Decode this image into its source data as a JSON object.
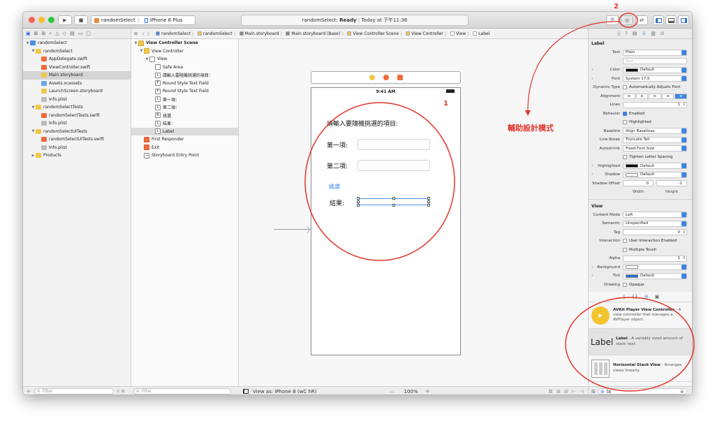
{
  "window": {
    "scheme_name": "randomSelect",
    "device": "iPhone 8 Plus",
    "status_project": "randomSelect:",
    "status_state": "Ready",
    "status_time": "Today at 下午11:38"
  },
  "jumpbar": [
    "randomSelect",
    "randomSelect",
    "Main.storyboard",
    "Main.storyboard (Base)",
    "View Controller Scene",
    "View Controller",
    "View",
    "Label"
  ],
  "navigator": [
    {
      "label": "randomSelect",
      "indent": 0,
      "tri": "▼",
      "icon": "#4a8ee8"
    },
    {
      "label": "randomSelect",
      "indent": 1,
      "tri": "▼",
      "icon": "#f0c64a"
    },
    {
      "label": "AppDelegate.swift",
      "indent": 2,
      "tri": "",
      "icon": "#f26b3a"
    },
    {
      "label": "ViewController.swift",
      "indent": 2,
      "tri": "",
      "icon": "#f26b3a"
    },
    {
      "label": "Main.storyboard",
      "indent": 2,
      "tri": "",
      "icon": "#f0c64a",
      "selected": true
    },
    {
      "label": "Assets.xcassets",
      "indent": 2,
      "tri": "",
      "icon": "#6aa7e6"
    },
    {
      "label": "LaunchScreen.storyboard",
      "indent": 2,
      "tri": "",
      "icon": "#f0c64a"
    },
    {
      "label": "Info.plist",
      "indent": 2,
      "tri": "",
      "icon": "#bbbbbb"
    },
    {
      "label": "randomSelectTests",
      "indent": 1,
      "tri": "▼",
      "icon": "#f0c64a"
    },
    {
      "label": "randomSelectTests.swift",
      "indent": 2,
      "tri": "",
      "icon": "#f26b3a"
    },
    {
      "label": "Info.plist",
      "indent": 2,
      "tri": "",
      "icon": "#bbbbbb"
    },
    {
      "label": "randomSelectUITests",
      "indent": 1,
      "tri": "▼",
      "icon": "#f0c64a"
    },
    {
      "label": "randomSelectUITests.swift",
      "indent": 2,
      "tri": "",
      "icon": "#f26b3a"
    },
    {
      "label": "Info.plist",
      "indent": 2,
      "tri": "",
      "icon": "#bbbbbb"
    },
    {
      "label": "Products",
      "indent": 1,
      "tri": "▶",
      "icon": "#f0c64a"
    }
  ],
  "outline": [
    {
      "label": "View Controller Scene",
      "indent": 0,
      "tri": "▼",
      "glyph": "",
      "bold": true
    },
    {
      "label": "View Controller",
      "indent": 1,
      "tri": "▼",
      "glyph": ""
    },
    {
      "label": "View",
      "indent": 2,
      "tri": "▼",
      "glyph": ""
    },
    {
      "label": "Safe Area",
      "indent": 3,
      "tri": "",
      "glyph": ""
    },
    {
      "label": "請輸入要隨機挑選的項目：",
      "indent": 3,
      "tri": "",
      "glyph": "L"
    },
    {
      "label": "Round Style Text Field",
      "indent": 3,
      "tri": "",
      "glyph": "F"
    },
    {
      "label": "Round Style Text Field",
      "indent": 3,
      "tri": "",
      "glyph": "F"
    },
    {
      "label": "第一項：",
      "indent": 3,
      "tri": "",
      "glyph": "L"
    },
    {
      "label": "第二項：",
      "indent": 3,
      "tri": "",
      "glyph": "L"
    },
    {
      "label": "挑選",
      "indent": 3,
      "tri": "",
      "glyph": "B"
    },
    {
      "label": "結果：",
      "indent": 3,
      "tri": "",
      "glyph": "L"
    },
    {
      "label": "Label",
      "indent": 3,
      "tri": "",
      "glyph": "L",
      "selected": true
    },
    {
      "label": "First Responder",
      "indent": 1,
      "tri": "",
      "glyph": ""
    },
    {
      "label": "Exit",
      "indent": 1,
      "tri": "",
      "glyph": ""
    },
    {
      "label": "Storyboard Entry Point",
      "indent": 1,
      "tri": "",
      "glyph": "→"
    }
  ],
  "phone": {
    "time": "9:41 AM",
    "prompt": "請輸入要隨機挑選的項目:",
    "item1": "第一項:",
    "item2": "第二項:",
    "pick": "挑選",
    "result": "結果:"
  },
  "canvas_footer": {
    "view_as": "View as: iPhone 8 (wC hR)",
    "zoom": "100%",
    "minus": "—",
    "plus": "+"
  },
  "filters": {
    "nav": "Filter",
    "outline": "Filter"
  },
  "inspector": {
    "label_section": "Label",
    "rows1": [
      {
        "label": "Text",
        "value": "Plain",
        "kind": "pop"
      },
      {
        "label": "",
        "value": "Text",
        "kind": "placeholder"
      },
      {
        "label": "Color",
        "value": "Default",
        "kind": "color",
        "swatch": "#000000",
        "plus": true
      },
      {
        "label": "Font",
        "value": "System 17.0",
        "kind": "pop",
        "plus": true
      },
      {
        "label": "Dynamic Type",
        "value": "Automatically Adjusts Font",
        "kind": "check"
      },
      {
        "label": "Alignment",
        "value": "",
        "kind": "align"
      },
      {
        "label": "Lines",
        "value": "1",
        "kind": "num"
      },
      {
        "label": "Behavior",
        "value": "Enabled",
        "kind": "check",
        "on": true
      },
      {
        "label": "",
        "value": "Highlighted",
        "kind": "check"
      },
      {
        "label": "Baseline",
        "value": "Align Baselines",
        "kind": "pop"
      },
      {
        "label": "Line Break",
        "value": "Truncate Tail",
        "kind": "pop"
      },
      {
        "label": "Autoshrink",
        "value": "Fixed Font Size",
        "kind": "pop"
      },
      {
        "label": "",
        "value": "Tighten Letter Spacing",
        "kind": "check"
      },
      {
        "label": "Highlighted",
        "value": "Default",
        "kind": "color",
        "swatch": "#000000",
        "plus": true
      },
      {
        "label": "Shadow",
        "value": "Default",
        "kind": "color",
        "swatch": "#ffffff",
        "plus": true
      },
      {
        "label": "Shadow Offset",
        "value": "0",
        "value2": "-1",
        "kind": "offset"
      },
      {
        "label": "",
        "value": "Width",
        "value2": "Height",
        "kind": "caption"
      }
    ],
    "view_section": "View",
    "rows2": [
      {
        "label": "Content Mode",
        "value": "Left",
        "kind": "pop"
      },
      {
        "label": "Semantic",
        "value": "Unspecified",
        "kind": "pop"
      },
      {
        "label": "Tag",
        "value": "0",
        "kind": "num"
      },
      {
        "label": "Interaction",
        "value": "User Interaction Enabled",
        "kind": "check"
      },
      {
        "label": "",
        "value": "Multiple Touch",
        "kind": "check"
      },
      {
        "label": "Alpha",
        "value": "1",
        "kind": "num"
      },
      {
        "label": "Background",
        "value": "",
        "kind": "color",
        "swatch": "#ffffff",
        "plus": true
      },
      {
        "label": "Tint",
        "value": "Default",
        "kind": "color",
        "swatch": "#2b6fd6",
        "plus": true
      },
      {
        "label": "Drawing",
        "value": "Opaque",
        "kind": "check"
      }
    ]
  },
  "library": [
    {
      "title": "AVKit Player View Controller",
      "desc": " - A view controller that manages a AVPlayer object.",
      "icon": "avkit"
    },
    {
      "title": "Label",
      "desc": " - A variably sized amount of static text.",
      "icon": "label",
      "selected": true,
      "icon_text": "Label"
    },
    {
      "title": "Horizontal Stack View",
      "desc": " - Arranges views linearly.",
      "icon": "stack"
    }
  ],
  "library_search": "la",
  "annotations": {
    "num1": "1",
    "num2": "2",
    "assist_text": "輔助設計模式",
    "color": "#e0362b"
  }
}
